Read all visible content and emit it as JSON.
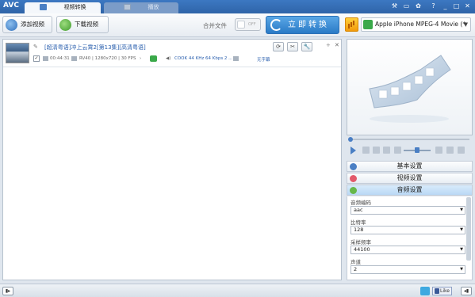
{
  "titlebar": {
    "app_logo": "AVC",
    "tabs": [
      {
        "label": "视频转换"
      },
      {
        "label": "播放"
      }
    ],
    "controls": [
      "wrench-icon",
      "monitor-icon",
      "gear-icon",
      "help-icon",
      "minimize-icon",
      "maximize-icon",
      "close-icon"
    ],
    "control_glyphs": [
      "⚒",
      "▭",
      "✿",
      "?",
      "_",
      "□",
      "✕"
    ]
  },
  "toolbar": {
    "add_video": "添加视频",
    "download_video": "下载视频",
    "merge_label": "合并文件",
    "merge_state": "OFF",
    "convert_now": "立即转换",
    "profile": "Apple iPhone MPEG-4 Movie (*"
  },
  "file": {
    "name": "[超清粤语]冲上云霄2[第13集][高清粤语]",
    "duration": "00:44:31",
    "video_info": "RV40 | 1280x720 | 30 FPS",
    "audio_info": "COOK 44 KHz 64 Kbps 2 ...",
    "subtitle": "无字幕",
    "checked": true
  },
  "row_buttons": [
    "⟳",
    "✂",
    "🔧"
  ],
  "accordion": {
    "basic": "基本设置",
    "video": "视频设置",
    "audio": "音频设置"
  },
  "audio_settings": [
    {
      "label": "音频编码",
      "value": "aac"
    },
    {
      "label": "比特率",
      "value": "128"
    },
    {
      "label": "采样频率",
      "value": "44100"
    },
    {
      "label": "声道",
      "value": "2"
    }
  ],
  "statusbar": {
    "fb_like": "Like"
  },
  "colors": {
    "title_bar": "#2f64a8",
    "accent": "#2a7ac6",
    "link": "#2a5fae"
  }
}
